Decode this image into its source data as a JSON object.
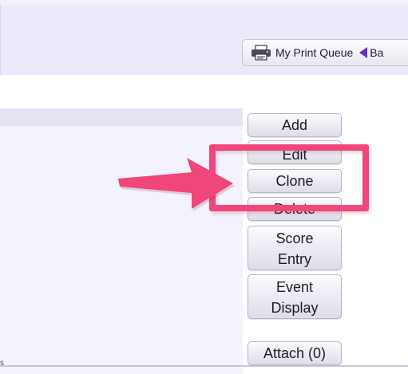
{
  "toolbar": {
    "print_queue_label": "My Print Queue",
    "back_label": "Ba",
    "printer_icon": "printer-icon",
    "back_icon": "back-arrow-icon"
  },
  "actions": {
    "add": "Add",
    "edit": "Edit",
    "clone": "Clone",
    "delete": "Delete",
    "score_entry_line1": "Score",
    "score_entry_line2": "Entry",
    "event_display_line1": "Event",
    "event_display_line2": "Display",
    "attach": "Attach (0)"
  },
  "footer": {
    "glyph": "s"
  },
  "colors": {
    "header_bg": "#ede9fb",
    "highlight": "#f0467a",
    "accent_purple": "#6a2fc8"
  }
}
